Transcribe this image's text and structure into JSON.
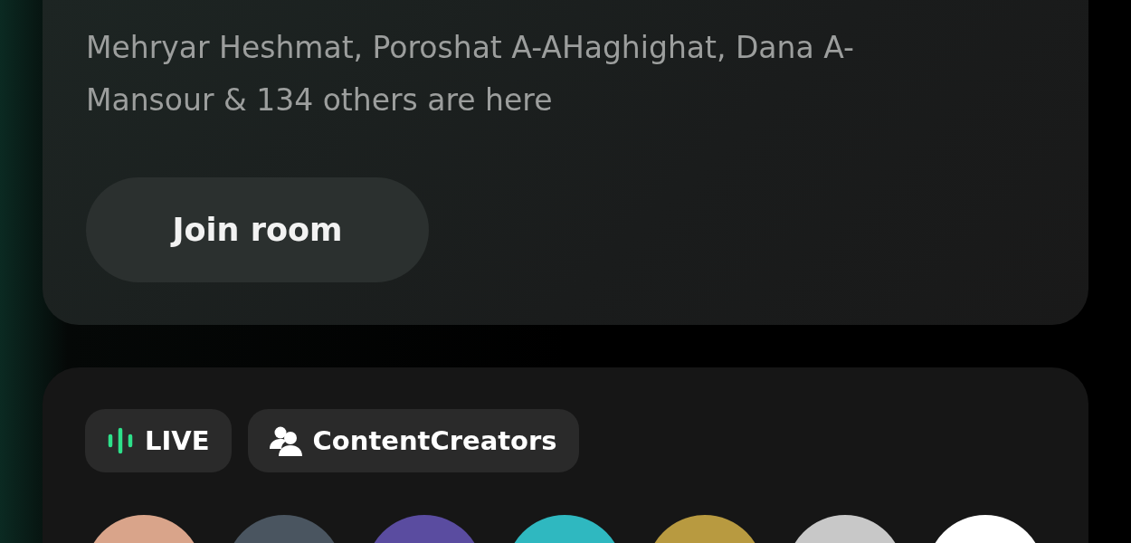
{
  "room_card": {
    "participants": "Mehryar Heshmat, Poroshat A-AHaghighat, Dana A-Mansour & 134 others are here",
    "join_button": "Join room"
  },
  "next_card": {
    "chips": [
      {
        "kind": "live",
        "label": "LIVE"
      },
      {
        "kind": "club",
        "label": "ContentCreators"
      }
    ],
    "avatars": [
      {
        "color": "#d9a48a"
      },
      {
        "color": "#4a5560"
      },
      {
        "color": "#5a4ca0"
      },
      {
        "color": "#2fb8c0"
      },
      {
        "color": "#b89a40"
      },
      {
        "color": "#c8c8c8"
      },
      {
        "color": "#ffffff"
      }
    ]
  }
}
